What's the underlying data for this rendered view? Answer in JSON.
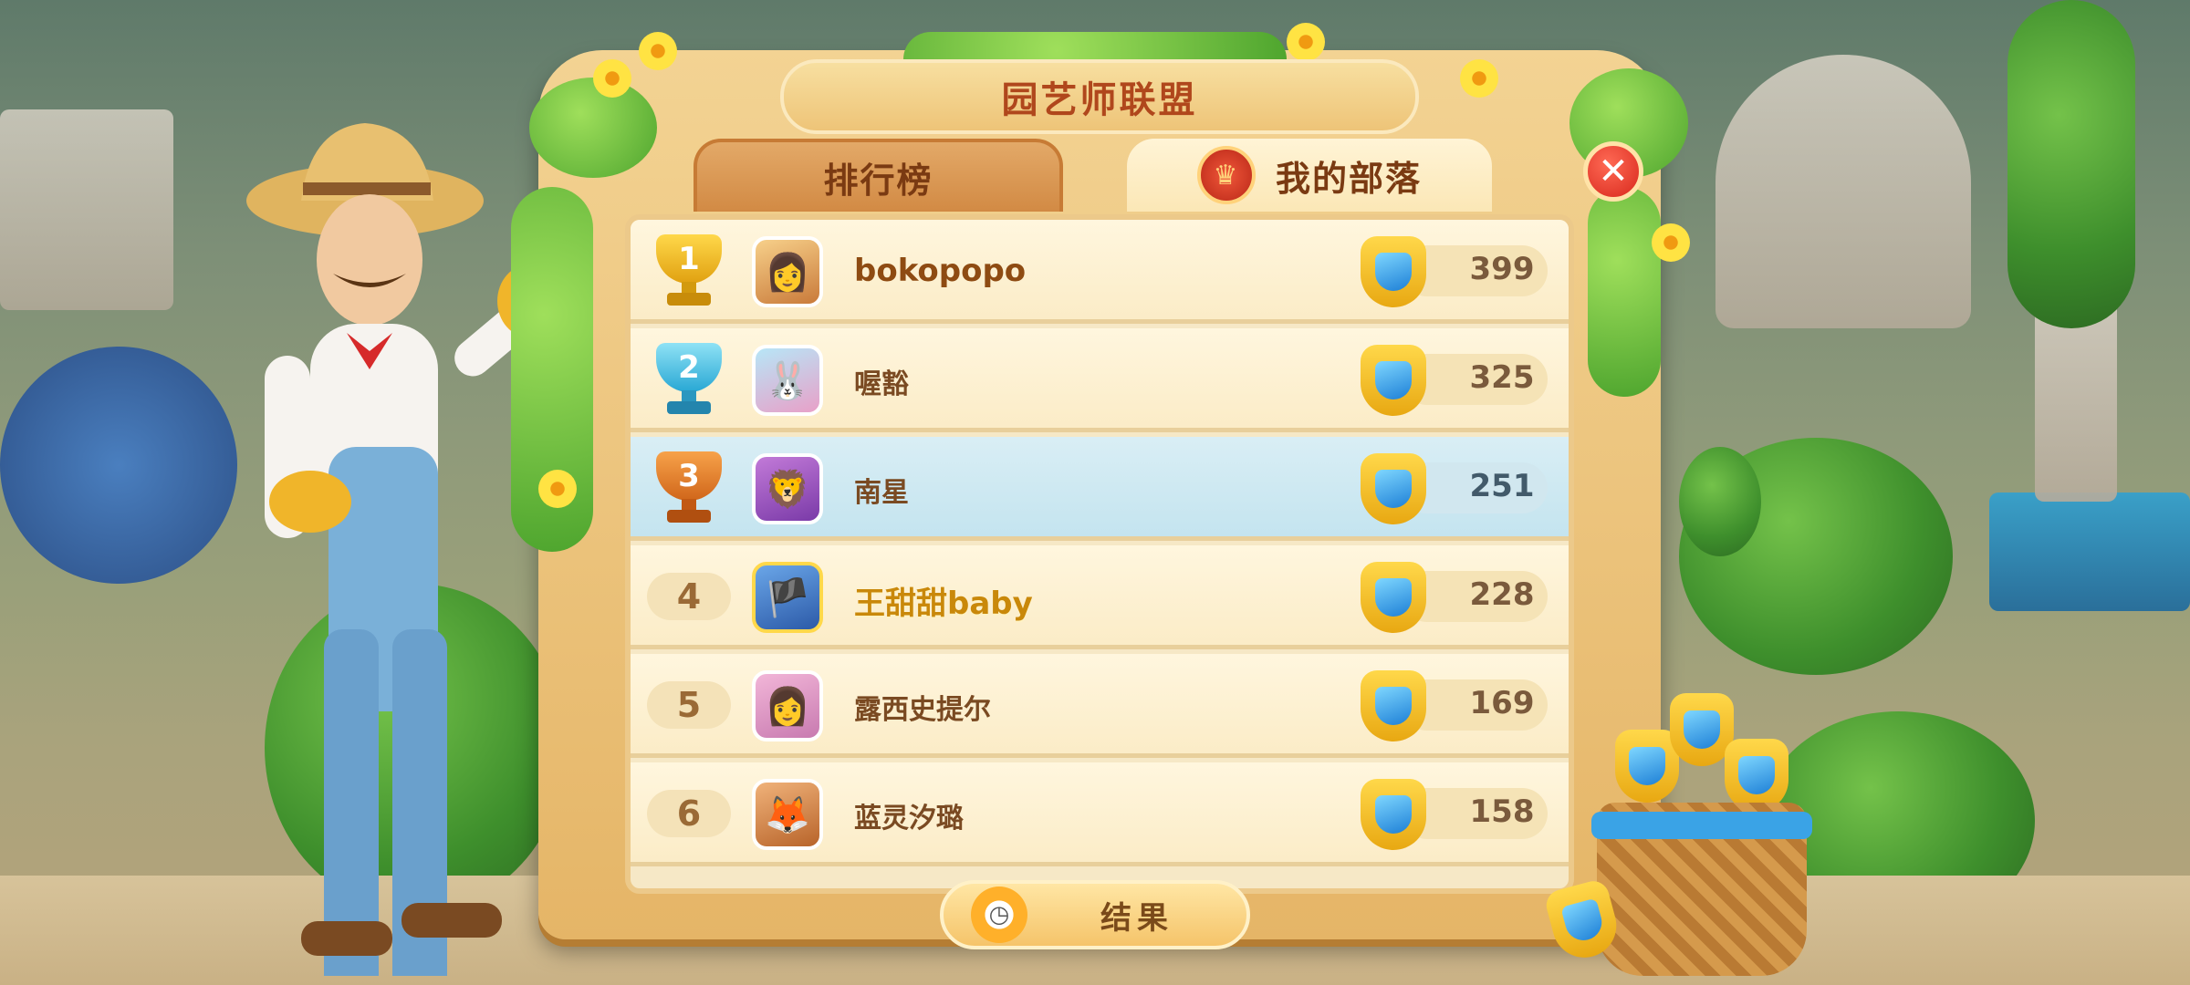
{
  "window": {
    "title": "园艺师联盟"
  },
  "tabs": [
    {
      "label": "排行榜",
      "active": false
    },
    {
      "label": "我的部落",
      "active": true
    }
  ],
  "close_icon": "close-icon",
  "leaderboard": {
    "rows": [
      {
        "rank": "1",
        "name": "bokopopo",
        "score": "399",
        "trophy": "gold",
        "avatar": "avatar-girl-flower"
      },
      {
        "rank": "2",
        "name": "喔豁",
        "score": "325",
        "trophy": "silver",
        "avatar": "avatar-bunny"
      },
      {
        "rank": "3",
        "name": "南星",
        "score": "251",
        "trophy": "bronze",
        "avatar": "avatar-lion-dance",
        "highlighted": true
      },
      {
        "rank": "4",
        "name": "王甜甜baby",
        "score": "228",
        "avatar": "avatar-pirate"
      },
      {
        "rank": "5",
        "name": "露西史提尔",
        "score": "169",
        "avatar": "avatar-woman"
      },
      {
        "rank": "6",
        "name": "蓝灵汐璐",
        "score": "158",
        "avatar": "avatar-fox"
      }
    ]
  },
  "footer": {
    "result_label": "结果",
    "timer_icon": "clock-icon"
  },
  "colors": {
    "title": "#b0471c",
    "gold_name": "#c9880a",
    "highlight_row": "#c4e4ef",
    "close_button": "#d8281c",
    "crest_gold": "#e8a812",
    "crest_gem": "#1d7fd6"
  }
}
